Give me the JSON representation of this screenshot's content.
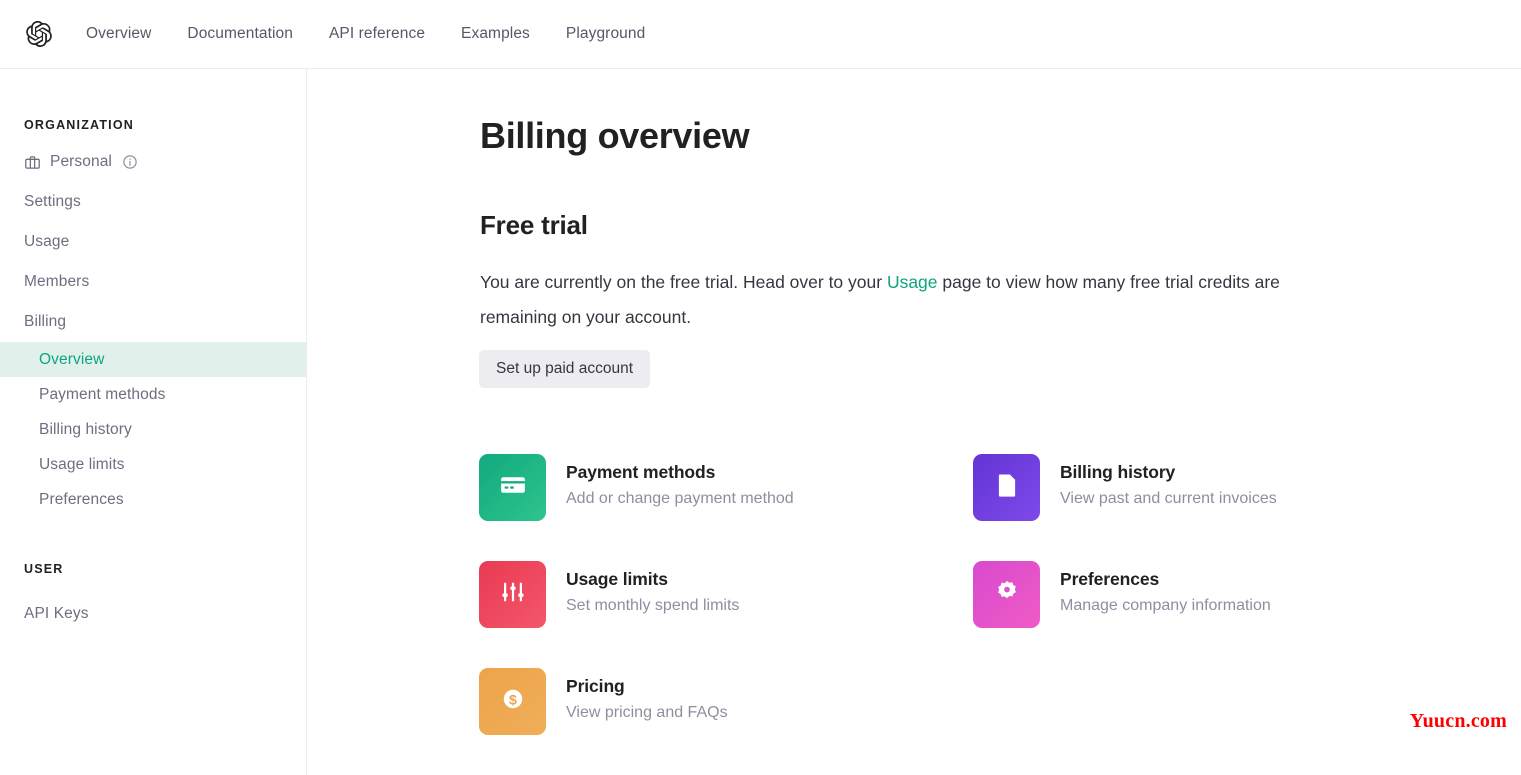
{
  "topnav": {
    "logo_icon": "openai-logo",
    "links": [
      {
        "label": "Overview"
      },
      {
        "label": "Documentation"
      },
      {
        "label": "API reference"
      },
      {
        "label": "Examples"
      },
      {
        "label": "Playground"
      }
    ]
  },
  "sidebar": {
    "org_heading": "ORGANIZATION",
    "org_items": [
      {
        "label": "Personal",
        "icon": "briefcase-icon",
        "info_icon": "info-circle-icon"
      },
      {
        "label": "Settings"
      },
      {
        "label": "Usage"
      },
      {
        "label": "Members"
      },
      {
        "label": "Billing"
      }
    ],
    "billing_subitems": [
      {
        "label": "Overview",
        "active": true
      },
      {
        "label": "Payment methods",
        "active": false
      },
      {
        "label": "Billing history",
        "active": false
      },
      {
        "label": "Usage limits",
        "active": false
      },
      {
        "label": "Preferences",
        "active": false
      }
    ],
    "user_heading": "USER",
    "user_items": [
      {
        "label": "API Keys"
      }
    ],
    "active_bg": "#e2f0ec",
    "active_color": "#10a37f"
  },
  "main": {
    "page_title": "Billing overview",
    "section_title": "Free trial",
    "paragraph_part1": "You are currently on the free trial. Head over to your ",
    "paragraph_link": "Usage",
    "paragraph_part2": " page to view how many free trial credits are remaining on your account.",
    "setup_button": "Set up paid account",
    "cards": [
      {
        "title": "Payment methods",
        "subtitle": "Add or change payment method",
        "icon": "credit-card-icon",
        "color_from": "#11a97f",
        "color_to": "#2fc48d"
      },
      {
        "title": "Billing history",
        "subtitle": "View past and current invoices",
        "icon": "document-icon",
        "color_from": "#6434d4",
        "color_to": "#7d4ae8"
      },
      {
        "title": "Usage limits",
        "subtitle": "Set monthly spend limits",
        "icon": "sliders-icon",
        "color_from": "#e83b53",
        "color_to": "#f4566a"
      },
      {
        "title": "Preferences",
        "subtitle": "Manage company information",
        "icon": "gear-icon",
        "color_from": "#d84ad0",
        "color_to": "#ef5bc4"
      },
      {
        "title": "Pricing",
        "subtitle": "View pricing and FAQs",
        "icon": "dollar-coin-icon",
        "color_from": "#eda44a",
        "color_to": "#f0ad58"
      }
    ]
  },
  "watermark": "Yuucn.com"
}
